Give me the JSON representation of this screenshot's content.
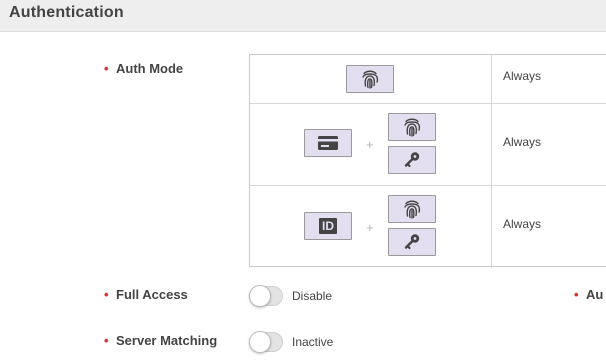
{
  "section": {
    "title": "Authentication"
  },
  "auth_mode": {
    "label": "Auth Mode",
    "rows": [
      {
        "icons": [
          "fingerprint-icon"
        ],
        "value": "Always"
      },
      {
        "icons": [
          "card-icon",
          "fingerprint-icon",
          "key-icon"
        ],
        "value": "Always"
      },
      {
        "icons": [
          "id-icon",
          "fingerprint-icon",
          "key-icon"
        ],
        "value": "Always"
      }
    ],
    "plus": "+",
    "id_text": "ID"
  },
  "full_access": {
    "label": "Full Access",
    "state": "Disable",
    "enabled": false
  },
  "server_matching": {
    "label": "Server Matching",
    "state": "Inactive",
    "enabled": false
  },
  "right_field": {
    "label_partial": "Au"
  },
  "colors": {
    "required": "#e0302a",
    "icon_bg": "#e4dff0",
    "icon_fg": "#444444"
  }
}
